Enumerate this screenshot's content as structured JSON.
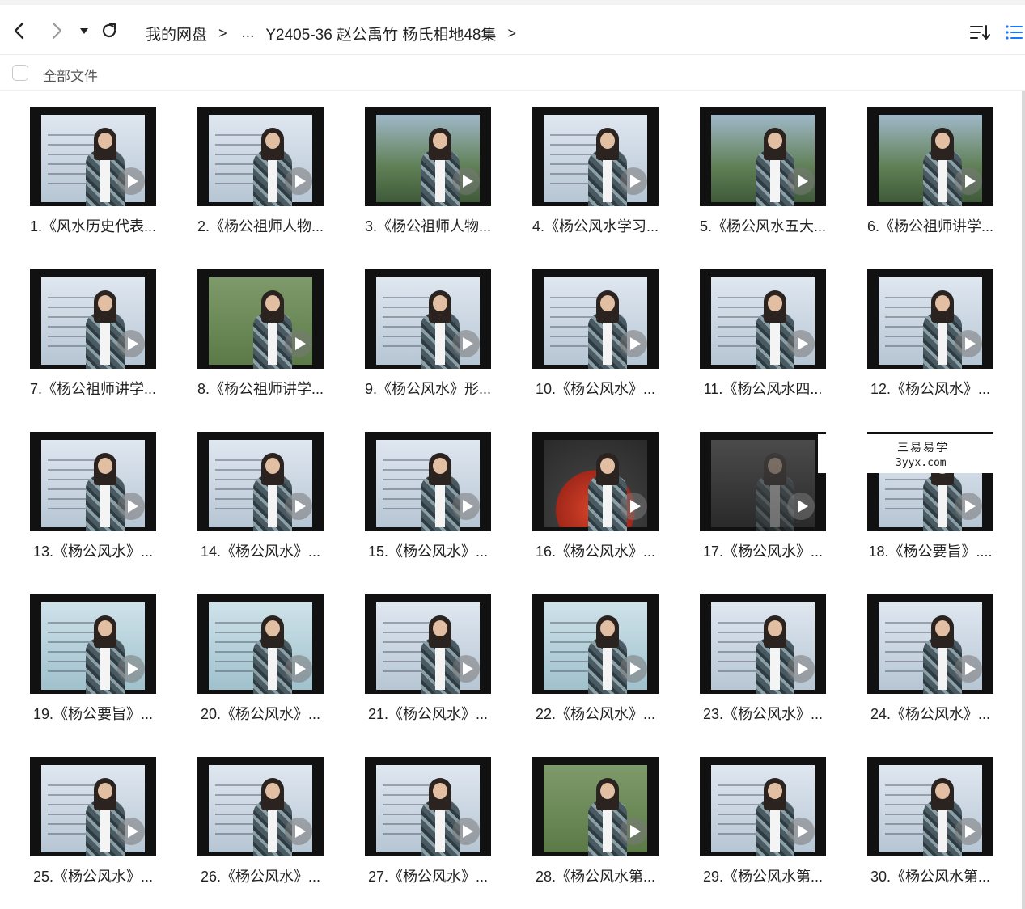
{
  "toolbar": {
    "back_icon": "chevron-left-icon",
    "forward_icon": "chevron-right-icon",
    "dropdown_icon": "caret-down-icon",
    "refresh_icon": "refresh-icon",
    "sort_icon": "sort-icon",
    "view_icon": "list-view-icon",
    "accent": "#1677ff"
  },
  "breadcrumb": {
    "items": [
      "我的网盘",
      "...",
      "Y2405-36 赵公禹竹 杨氏相地48集"
    ]
  },
  "selectbar": {
    "label": "全部文件"
  },
  "watermark": {
    "line1": "三易易学",
    "line2": "3yyx.com"
  },
  "files": [
    {
      "name": "1.《风水历史代表...",
      "style": "person"
    },
    {
      "name": "2.《杨公祖师人物...",
      "style": "person"
    },
    {
      "name": "3.《杨公祖师人物...",
      "style": "photo"
    },
    {
      "name": "4.《杨公风水学习...",
      "style": "person"
    },
    {
      "name": "5.《杨公风水五大...",
      "style": "photo"
    },
    {
      "name": "6.《杨公祖师讲学...",
      "style": "photo"
    },
    {
      "name": "7.《杨公祖师讲学...",
      "style": "person"
    },
    {
      "name": "8.《杨公祖师讲学...",
      "style": "map"
    },
    {
      "name": "9.《杨公风水》形...",
      "style": "person"
    },
    {
      "name": "10.《杨公风水》...",
      "style": "person"
    },
    {
      "name": "11.《杨公风水四...",
      "style": "person"
    },
    {
      "name": "12.《杨公风水》...",
      "style": "person"
    },
    {
      "name": "13.《杨公风水》...",
      "style": "person"
    },
    {
      "name": "14.《杨公风水》...",
      "style": "person"
    },
    {
      "name": "15.《杨公风水》...",
      "style": "person"
    },
    {
      "name": "16.《杨公风水》...",
      "style": "food"
    },
    {
      "name": "17.《杨公风水》...",
      "style": "dark"
    },
    {
      "name": "18.《杨公要旨》....",
      "style": "person"
    },
    {
      "name": "19.《杨公要旨》...",
      "style": "board"
    },
    {
      "name": "20.《杨公风水》...",
      "style": "board"
    },
    {
      "name": "21.《杨公风水》...",
      "style": "person"
    },
    {
      "name": "22.《杨公风水》...",
      "style": "board"
    },
    {
      "name": "23.《杨公风水》...",
      "style": "person"
    },
    {
      "name": "24.《杨公风水》...",
      "style": "person"
    },
    {
      "name": "25.《杨公风水》...",
      "style": "person"
    },
    {
      "name": "26.《杨公风水》...",
      "style": "person"
    },
    {
      "name": "27.《杨公风水》...",
      "style": "person"
    },
    {
      "name": "28.《杨公风水第...",
      "style": "map"
    },
    {
      "name": "29.《杨公风水第...",
      "style": "person"
    },
    {
      "name": "30.《杨公风水第...",
      "style": "person"
    }
  ]
}
